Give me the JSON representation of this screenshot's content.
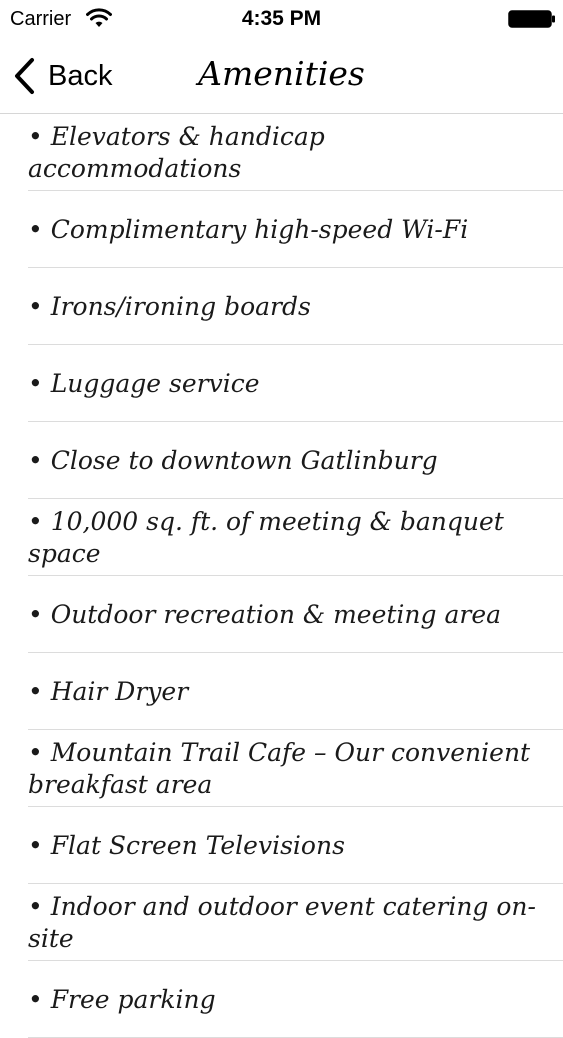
{
  "status_bar": {
    "carrier": "Carrier",
    "time": "4:35 PM",
    "icons": [
      "wifi-icon",
      "battery-icon"
    ]
  },
  "nav": {
    "back_label": "Back",
    "back_icon": "chevron-left-icon",
    "title": "Amenities"
  },
  "amenities": [
    "• Elevators & handicap accommodations",
    "• Complimentary high-speed Wi-Fi",
    "• Irons/ironing boards",
    "• Luggage service",
    "• Close to downtown Gatlinburg",
    "• 10,000 sq. ft. of meeting & banquet space",
    "• Outdoor recreation & meeting area",
    "• Hair Dryer",
    "• Mountain Trail Cafe – Our convenient breakfast area",
    "• Flat Screen Televisions",
    "• Indoor and outdoor event catering on-site",
    "• Free parking"
  ]
}
